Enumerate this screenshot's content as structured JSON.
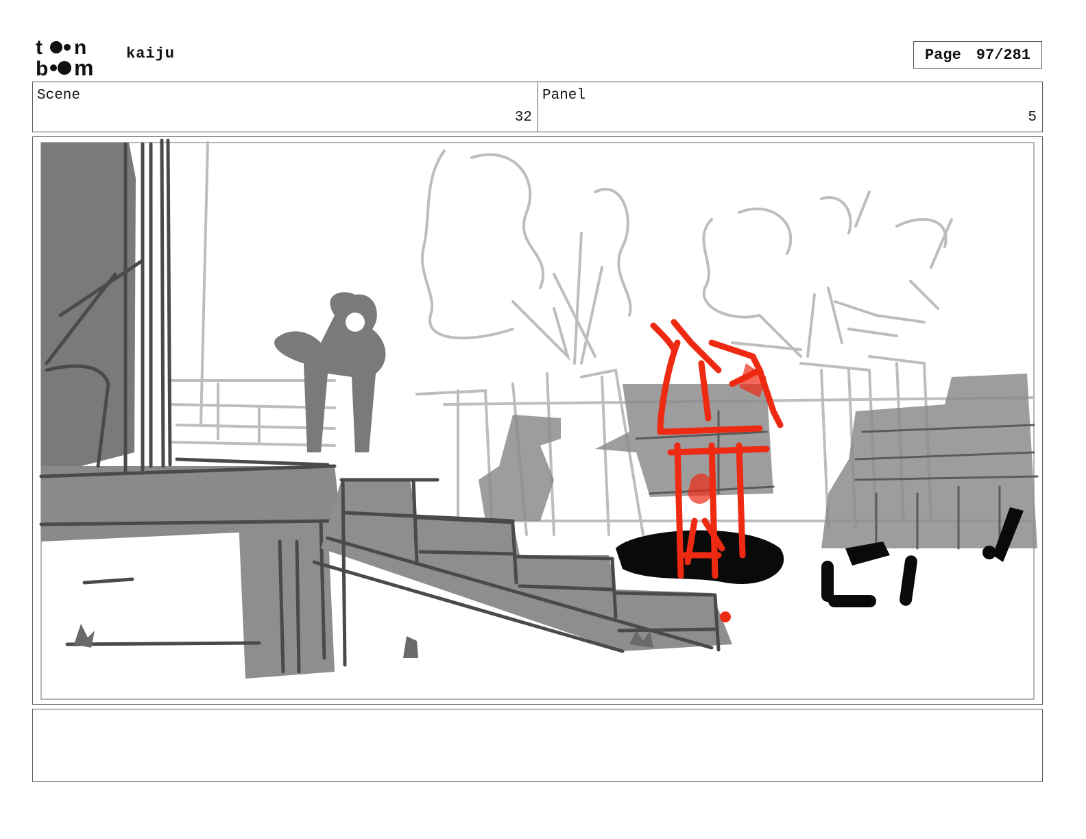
{
  "header": {
    "logo_text": "toonboom",
    "project": "kaiju",
    "page_label": "Page",
    "page_value": "97/281"
  },
  "info": {
    "scene_label": "Scene",
    "scene_value": "32",
    "panel_label": "Panel",
    "panel_value": "5"
  },
  "notes": {
    "text": ""
  },
  "colors": {
    "border": "#555555",
    "sketch_dark": "#4a4a4a",
    "sketch_mid": "#8c8c8c",
    "sketch_light": "#bdbdbd",
    "accent_red": "#ee2a12",
    "ink_black": "#0a0a0a"
  }
}
